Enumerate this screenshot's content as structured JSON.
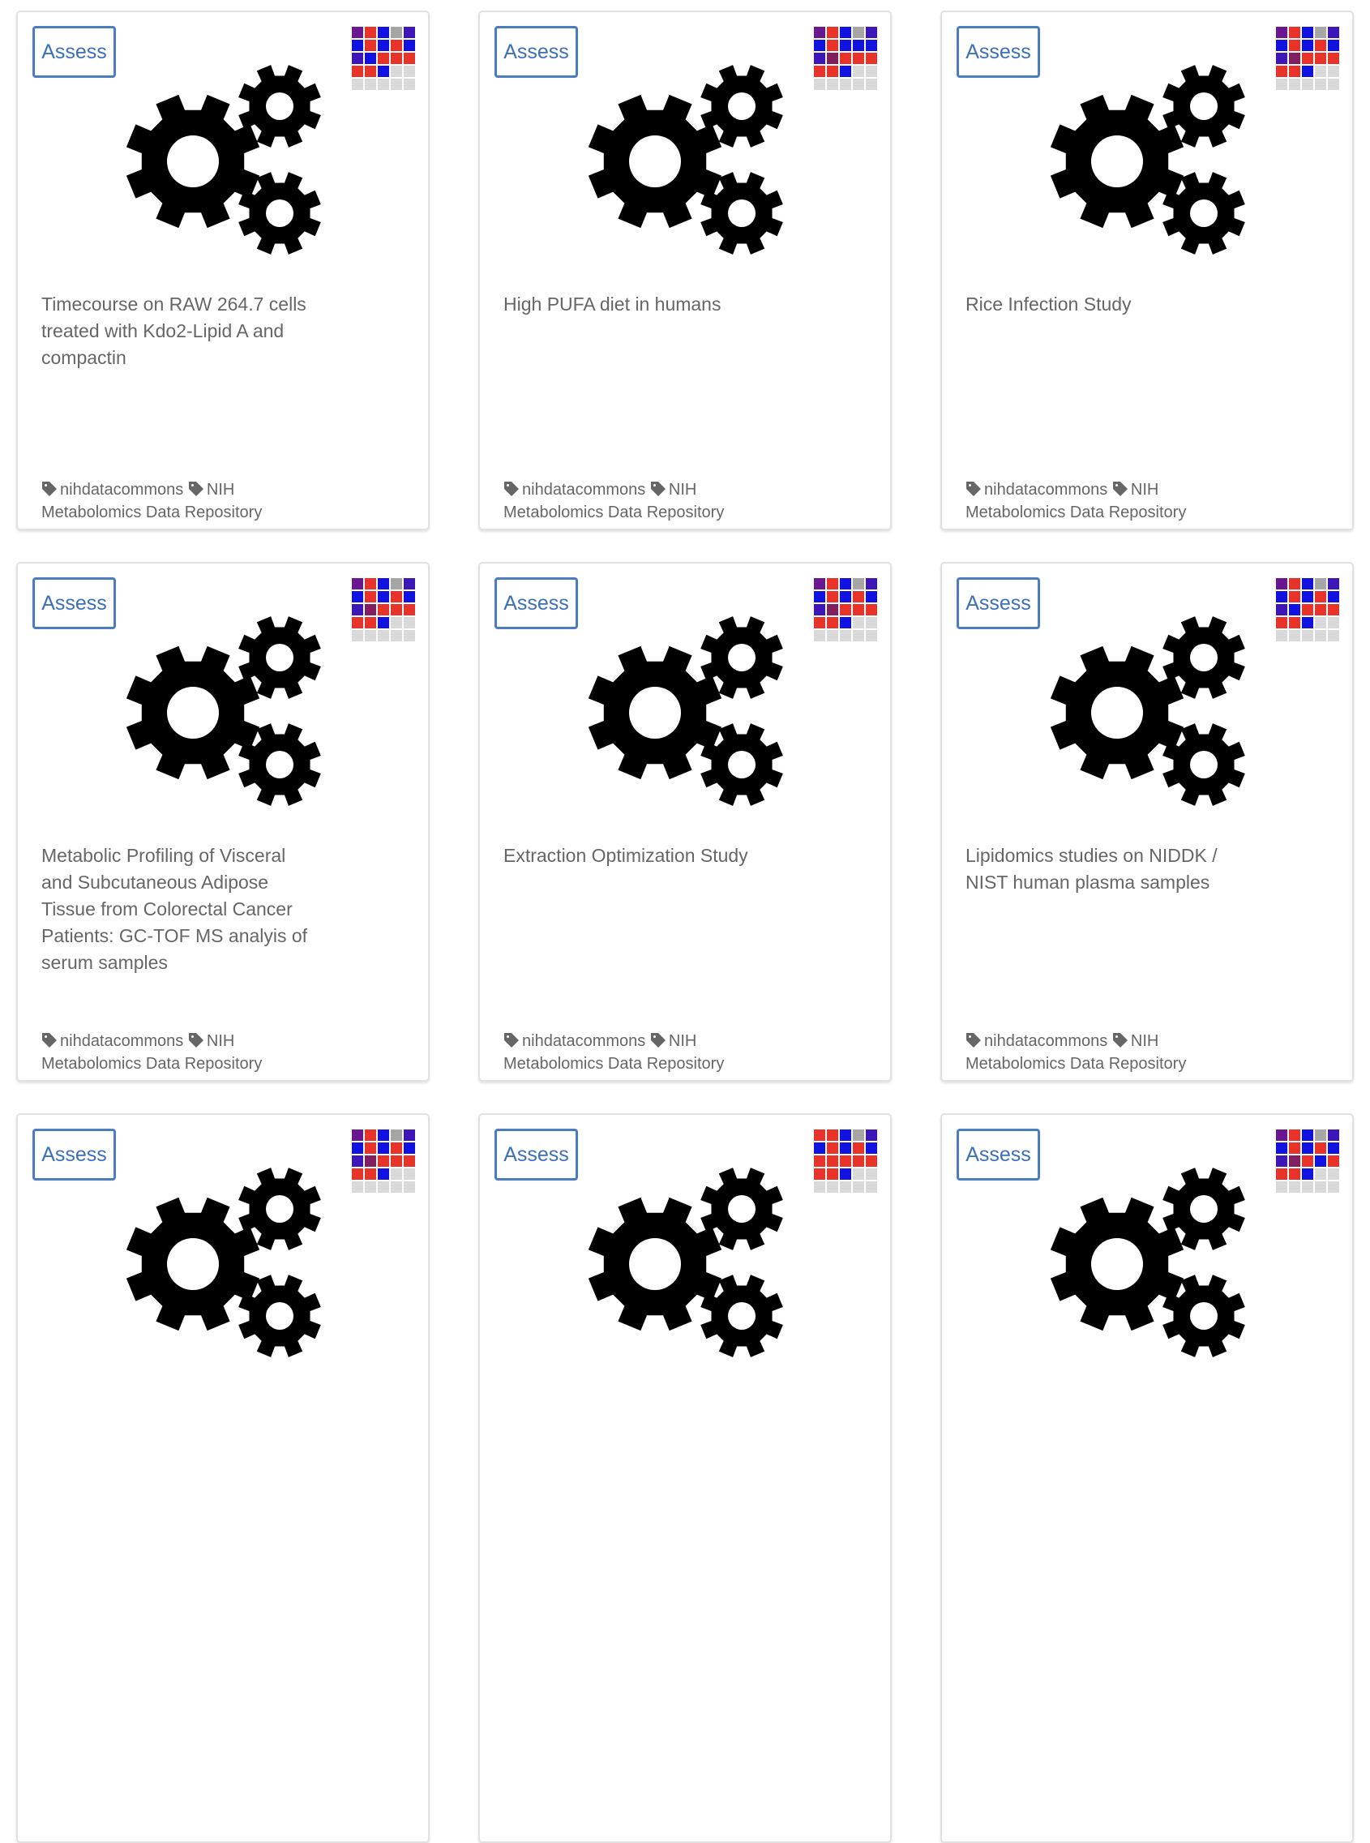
{
  "palette": {
    "red": "#e8332a",
    "blue": "#1212e0",
    "purple": "#6a188f",
    "gray": "#a6a6a6",
    "light": "#d9d9d9",
    "indigo": "#3d16b7",
    "maroon": "#802060"
  },
  "assess_label": "Assess",
  "cards": [
    {
      "title": "Timecourse on RAW 264.7 cells treated with Kdo2-Lipid A and compactin",
      "tags": [
        "nihdatacommons",
        "NIH Metabolomics Data Repository"
      ],
      "insignia": [
        "purple",
        "red",
        "blue",
        "gray",
        "indigo",
        "blue",
        "red",
        "blue",
        "red",
        "blue",
        "indigo",
        "blue",
        "red",
        "red",
        "red",
        "red",
        "red",
        "blue",
        "light",
        "light",
        "light",
        "light",
        "light",
        "light",
        "light"
      ]
    },
    {
      "title": "High PUFA diet in humans",
      "tags": [
        "nihdatacommons",
        "NIH Metabolomics Data Repository"
      ],
      "insignia": [
        "purple",
        "red",
        "blue",
        "gray",
        "indigo",
        "blue",
        "red",
        "blue",
        "blue",
        "blue",
        "indigo",
        "maroon",
        "red",
        "red",
        "red",
        "red",
        "red",
        "blue",
        "light",
        "light",
        "light",
        "light",
        "light",
        "light",
        "light"
      ]
    },
    {
      "title": "Rice Infection Study",
      "tags": [
        "nihdatacommons",
        "NIH Metabolomics Data Repository"
      ],
      "insignia": [
        "purple",
        "red",
        "blue",
        "gray",
        "indigo",
        "blue",
        "red",
        "blue",
        "red",
        "blue",
        "indigo",
        "maroon",
        "red",
        "red",
        "red",
        "red",
        "red",
        "blue",
        "light",
        "light",
        "light",
        "light",
        "light",
        "light",
        "light"
      ]
    },
    {
      "title": "Metabolic Profiling of Visceral and Subcutaneous Adipose Tissue from Colorectal Cancer Patients: GC-TOF MS analyis of serum samples",
      "tags": [
        "nihdatacommons",
        "NIH Metabolomics Data Repository"
      ],
      "insignia": [
        "purple",
        "red",
        "blue",
        "gray",
        "indigo",
        "blue",
        "red",
        "blue",
        "red",
        "blue",
        "indigo",
        "maroon",
        "red",
        "red",
        "red",
        "red",
        "red",
        "blue",
        "light",
        "light",
        "light",
        "light",
        "light",
        "light",
        "light"
      ]
    },
    {
      "title": "Extraction Optimization Study",
      "tags": [
        "nihdatacommons",
        "NIH Metabolomics Data Repository"
      ],
      "insignia": [
        "purple",
        "red",
        "blue",
        "gray",
        "indigo",
        "blue",
        "red",
        "blue",
        "red",
        "blue",
        "indigo",
        "maroon",
        "red",
        "red",
        "red",
        "red",
        "red",
        "blue",
        "light",
        "light",
        "light",
        "light",
        "light",
        "light",
        "light"
      ]
    },
    {
      "title": "Lipidomics studies on NIDDK / NIST human plasma samples",
      "tags": [
        "nihdatacommons",
        "NIH Metabolomics Data Repository"
      ],
      "insignia": [
        "purple",
        "red",
        "blue",
        "gray",
        "indigo",
        "blue",
        "red",
        "blue",
        "red",
        "blue",
        "indigo",
        "blue",
        "red",
        "red",
        "red",
        "red",
        "red",
        "blue",
        "light",
        "light",
        "light",
        "light",
        "light",
        "light",
        "light"
      ]
    },
    {
      "title": "",
      "tags": [],
      "insignia": [
        "purple",
        "red",
        "blue",
        "gray",
        "indigo",
        "blue",
        "red",
        "blue",
        "red",
        "blue",
        "indigo",
        "maroon",
        "red",
        "red",
        "red",
        "red",
        "red",
        "blue",
        "light",
        "light",
        "light",
        "light",
        "light",
        "light",
        "light"
      ]
    },
    {
      "title": "",
      "tags": [],
      "insignia": [
        "red",
        "red",
        "blue",
        "gray",
        "indigo",
        "blue",
        "red",
        "blue",
        "red",
        "blue",
        "red",
        "red",
        "red",
        "red",
        "red",
        "red",
        "red",
        "blue",
        "light",
        "light",
        "light",
        "light",
        "light",
        "light",
        "light"
      ]
    },
    {
      "title": "",
      "tags": [],
      "insignia": [
        "purple",
        "red",
        "blue",
        "gray",
        "indigo",
        "blue",
        "red",
        "blue",
        "red",
        "blue",
        "indigo",
        "maroon",
        "red",
        "blue",
        "red",
        "red",
        "red",
        "blue",
        "light",
        "light",
        "light",
        "light",
        "light",
        "light",
        "light"
      ]
    }
  ]
}
